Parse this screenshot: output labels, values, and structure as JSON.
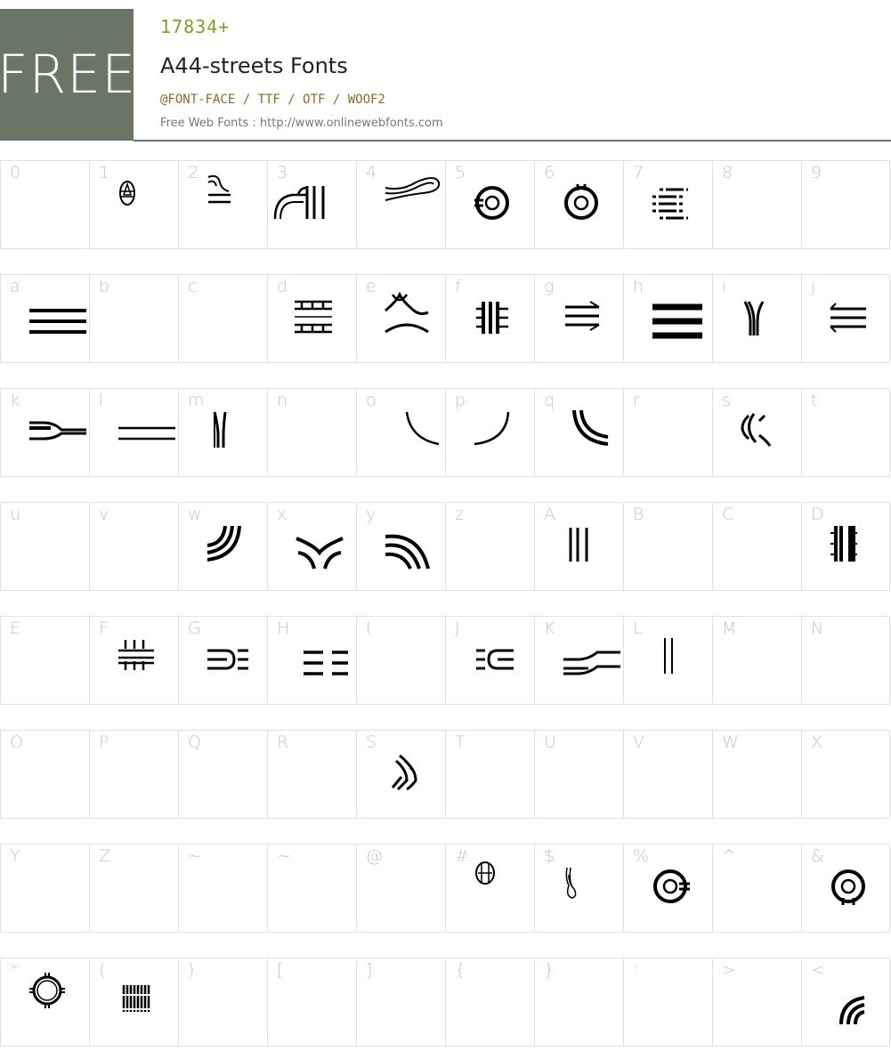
{
  "header": {
    "badge": "FREE",
    "count": "17834+",
    "title": "A44-streets Fonts",
    "formats": "@FONT-FACE / TTF / OTF / WOOF2",
    "credit": "Free Web Fonts : http://www.onlinewebfonts.com"
  },
  "colors": {
    "badge_bg": "#6b7565",
    "count": "#8a9a2a",
    "formats": "#8a6a2a",
    "grid_line": "#e2e2e2",
    "char_label": "#c4c4c4",
    "glyph": "#000000"
  },
  "glyph_rows": [
    [
      "0",
      "1",
      "2",
      "3",
      "4",
      "5",
      "6",
      "7",
      "8",
      "9"
    ],
    [
      "a",
      "b",
      "c",
      "d",
      "e",
      "f",
      "g",
      "h",
      "i",
      "j"
    ],
    [
      "k",
      "l",
      "m",
      "n",
      "o",
      "p",
      "q",
      "r",
      "s",
      "t"
    ],
    [
      "u",
      "v",
      "w",
      "x",
      "y",
      "z",
      "A",
      "B",
      "C",
      "D"
    ],
    [
      "E",
      "F",
      "G",
      "H",
      "I",
      "J",
      "K",
      "L",
      "M",
      "N"
    ],
    [
      "O",
      "P",
      "Q",
      "R",
      "S",
      "T",
      "U",
      "V",
      "W",
      "X"
    ],
    [
      "Y",
      "Z",
      "~",
      "~",
      "@",
      "#",
      "$",
      "%",
      "^",
      "&"
    ],
    [
      "*",
      "(",
      ")",
      "[",
      "]",
      "{",
      "}",
      ":",
      ">",
      "<"
    ]
  ]
}
